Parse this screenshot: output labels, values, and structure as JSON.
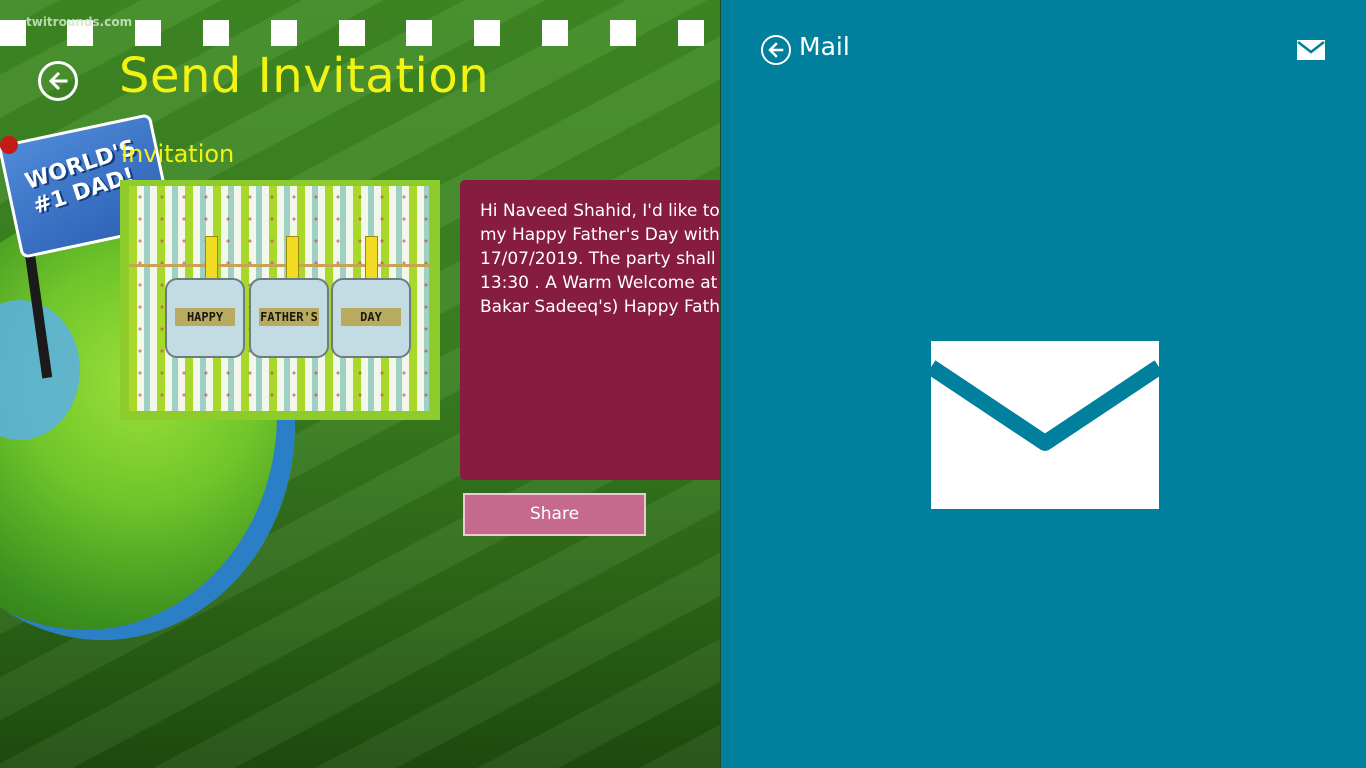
{
  "app": {
    "watermark": "twitrounds.com",
    "title": "Send Invitation",
    "section_label": "Invitation",
    "flag_text": "WORLD'S #1 DAD!",
    "card_tags": [
      "HAPPY",
      "FATHER'S",
      "DAY"
    ],
    "message_lines": [
      "Hi Naveed Shahid, I'd like to",
      "my Happy Father's Day with",
      "17/07/2019. The party shall",
      "13:30 . A Warm Welcome at",
      "Bakar Sadeeq's) Happy Fath"
    ],
    "share_label": "Share"
  },
  "mail_pane": {
    "title": "Mail",
    "accent": "#00809c"
  },
  "colors": {
    "title_yellow": "#f3f313",
    "message_bg": "#861c40",
    "share_bg": "#c56a8c"
  }
}
